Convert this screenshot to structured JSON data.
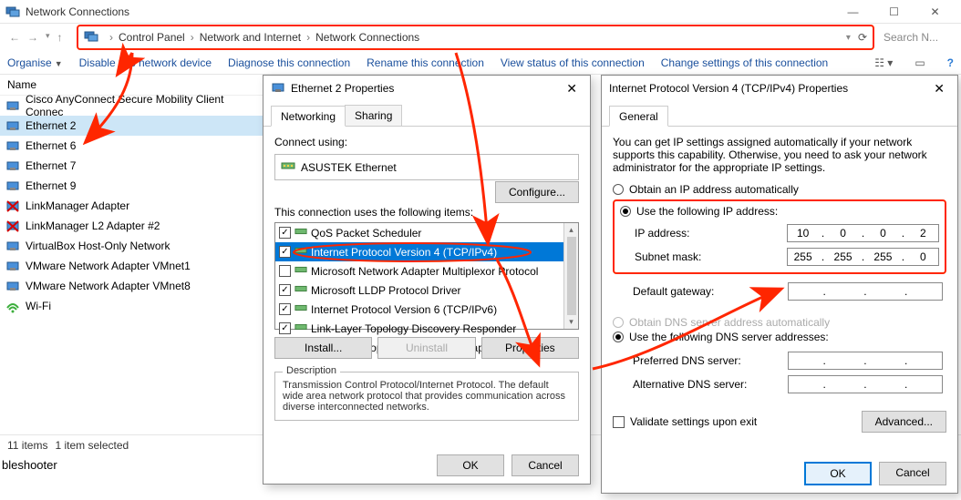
{
  "window": {
    "title": "Network Connections",
    "win_min": "—",
    "win_max": "☐",
    "win_close": "✕"
  },
  "breadcrumb": {
    "back": "←",
    "fwd": "→",
    "up": "↑",
    "seg1": "Control Panel",
    "seg2": "Network and Internet",
    "seg3": "Network Connections",
    "chev": "›",
    "refresh": "⟳",
    "search_placeholder": "Search N..."
  },
  "toolbar": {
    "organise": "Organise",
    "disable": "Disable this network device",
    "diagnose": "Diagnose this connection",
    "rename": "Rename this connection",
    "viewstatus": "View status of this connection",
    "change": "Change settings of this connection"
  },
  "list": {
    "col_name": "Name",
    "items": [
      {
        "label": "Cisco AnyConnect Secure Mobility Client Connec",
        "type": "net"
      },
      {
        "label": "Ethernet 2",
        "type": "net",
        "selected": true
      },
      {
        "label": "Ethernet 6",
        "type": "net"
      },
      {
        "label": "Ethernet 7",
        "type": "net"
      },
      {
        "label": "Ethernet 9",
        "type": "net"
      },
      {
        "label": "LinkManager Adapter",
        "type": "net-x"
      },
      {
        "label": "LinkManager L2 Adapter #2",
        "type": "net-x"
      },
      {
        "label": "VirtualBox Host-Only Network",
        "type": "net"
      },
      {
        "label": "VMware Network Adapter VMnet1",
        "type": "net"
      },
      {
        "label": "VMware Network Adapter VMnet8",
        "type": "net"
      },
      {
        "label": "Wi-Fi",
        "type": "wifi"
      }
    ]
  },
  "statusbar": {
    "count": "11 items",
    "sel": "1 item selected"
  },
  "troubleshooter": "bleshooter",
  "dlg1": {
    "title": "Ethernet 2 Properties",
    "tab_networking": "Networking",
    "tab_sharing": "Sharing",
    "connect_using": "Connect using:",
    "adapter": "ASUSTEK Ethernet",
    "configure_btn": "Configure...",
    "items_label": "This connection uses the following items:",
    "items": [
      {
        "chk": true,
        "label": "QoS Packet Scheduler",
        "selected": false
      },
      {
        "chk": true,
        "label": "Internet Protocol Version 4 (TCP/IPv4)",
        "selected": true
      },
      {
        "chk": false,
        "label": "Microsoft Network Adapter Multiplexor Protocol"
      },
      {
        "chk": true,
        "label": "Microsoft LLDP Protocol Driver"
      },
      {
        "chk": true,
        "label": "Internet Protocol Version 6 (TCP/IPv6)"
      },
      {
        "chk": true,
        "label": "Link-Layer Topology Discovery Responder"
      },
      {
        "chk": true,
        "label": "Link-Layer Topology Discovery Mapper I/O Driver"
      }
    ],
    "install_btn": "Install...",
    "uninstall_btn": "Uninstall",
    "properties_btn": "Properties",
    "desc_head": "Description",
    "desc_text": "Transmission Control Protocol/Internet Protocol. The default wide area network protocol that provides communication across diverse interconnected networks.",
    "ok": "OK",
    "cancel": "Cancel"
  },
  "dlg2": {
    "title": "Internet Protocol Version 4 (TCP/IPv4) Properties",
    "tab_general": "General",
    "blurb": "You can get IP settings assigned automatically if your network supports this capability. Otherwise, you need to ask your network administrator for the appropriate IP settings.",
    "r_auto_ip": "Obtain an IP address automatically",
    "r_use_ip": "Use the following IP address:",
    "ip_label": "IP address:",
    "ip_value": [
      "10",
      "0",
      "0",
      "2"
    ],
    "mask_label": "Subnet mask:",
    "mask_value": [
      "255",
      "255",
      "255",
      "0"
    ],
    "gw_label": "Default gateway:",
    "gw_value": [
      "",
      "",
      "",
      ""
    ],
    "r_auto_dns": "Obtain DNS server address automatically",
    "r_use_dns": "Use the following DNS server addresses:",
    "pdns_label": "Preferred DNS server:",
    "pdns_value": [
      "",
      "",
      "",
      ""
    ],
    "adns_label": "Alternative DNS server:",
    "adns_value": [
      "",
      "",
      "",
      ""
    ],
    "validate": "Validate settings upon exit",
    "advanced": "Advanced...",
    "ok": "OK",
    "cancel": "Cancel"
  }
}
